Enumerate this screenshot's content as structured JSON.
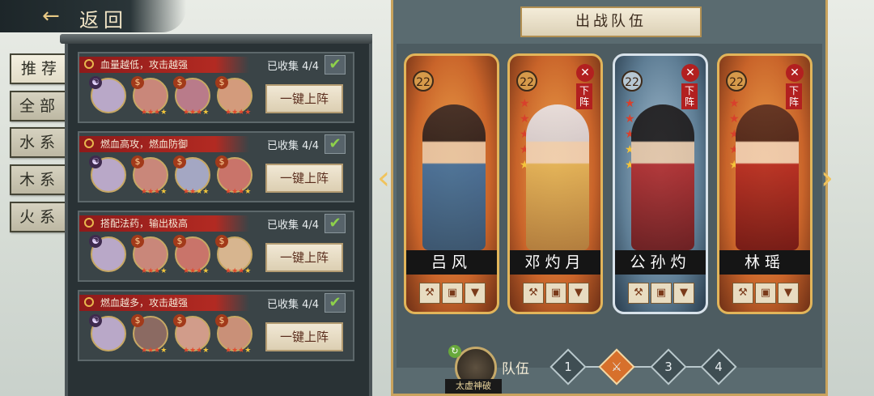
{
  "header": {
    "back_label": "返回",
    "back_icon": "swirl-back-icon"
  },
  "tabs": [
    "推荐",
    "全部",
    "水系",
    "木系",
    "火系"
  ],
  "active_tab_index": 0,
  "lineups": [
    {
      "skill": "血量越低，攻击越强",
      "collected": "已收集 4/4",
      "button": "一键上阵"
    },
    {
      "skill": "燃血高攻，燃血防御",
      "collected": "已收集 4/4",
      "button": "一键上阵"
    },
    {
      "skill": "搭配法药，输出极高",
      "collected": "已收集 4/4",
      "button": "一键上阵"
    },
    {
      "skill": "燃血越多，攻击越强",
      "collected": "已收集 4/4",
      "button": "一键上阵"
    }
  ],
  "team": {
    "title": "出战队伍",
    "heroes": [
      {
        "name": "吕风",
        "level": "22",
        "red_stars": 0,
        "gold_stars": 0,
        "removable": false,
        "frame": "gold"
      },
      {
        "name": "邓灼月",
        "level": "22",
        "red_stars": 4,
        "gold_stars": 1,
        "removable": true,
        "frame": "gold"
      },
      {
        "name": "公孙灼",
        "level": "22",
        "red_stars": 3,
        "gold_stars": 2,
        "removable": true,
        "frame": "blue"
      },
      {
        "name": "林瑶",
        "level": "22",
        "red_stars": 4,
        "gold_stars": 1,
        "removable": true,
        "frame": "gold"
      }
    ],
    "remove_label": "下阵",
    "remove_icon": "x-icon"
  },
  "footer": {
    "skill_name": "太虚神破",
    "team_label": "队伍",
    "slots": [
      "1",
      "",
      "3",
      "4"
    ],
    "active_slot_index": 1
  },
  "colors": {
    "accent_gold": "#c9a35d",
    "skill_red": "#b22a22",
    "remove_red": "#b22020"
  }
}
